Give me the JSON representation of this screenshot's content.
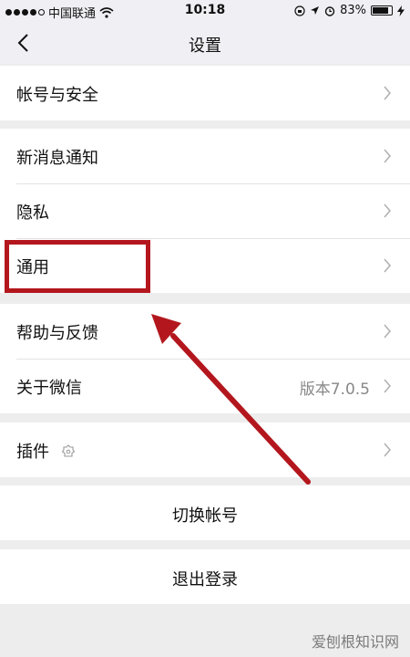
{
  "status_bar": {
    "carrier": "中国联通",
    "time": "10:18",
    "battery": "83%",
    "battery_level": 0.83
  },
  "nav": {
    "title": "设置",
    "back_icon": "chevron-left-icon"
  },
  "groups": [
    {
      "items": [
        {
          "label": "帐号与安全"
        }
      ]
    },
    {
      "items": [
        {
          "label": "新消息通知"
        },
        {
          "label": "隐私"
        },
        {
          "label": "通用"
        }
      ]
    },
    {
      "items": [
        {
          "label": "帮助与反馈"
        },
        {
          "label": "关于微信",
          "value": "版本7.0.5"
        }
      ]
    },
    {
      "items": [
        {
          "label": "插件",
          "icon": "plugin-icon"
        }
      ]
    }
  ],
  "actions": {
    "switch_account": "切换帐号",
    "logout": "退出登录"
  },
  "annotation": {
    "color": "#b3171d"
  },
  "watermark": "爱刨根知识网"
}
